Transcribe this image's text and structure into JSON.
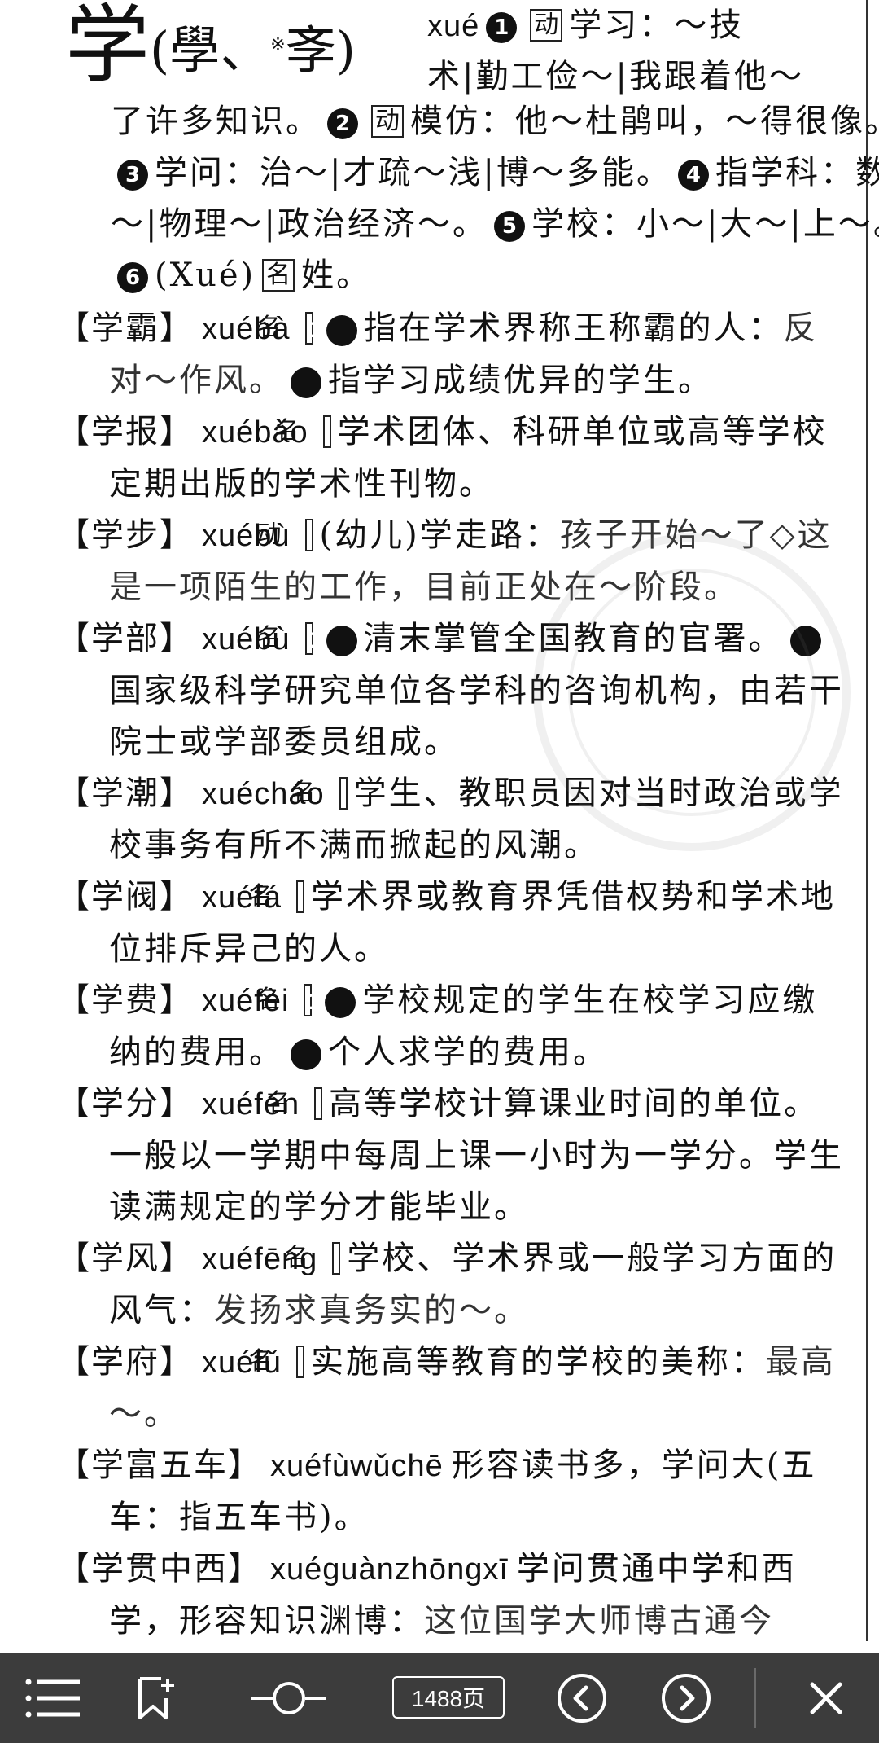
{
  "head_entry": {
    "char": "学",
    "variants_open": "(",
    "variant_1": "學",
    "variant_sep": "、",
    "variant_star": "※",
    "variant_2": "斈",
    "variants_close": ")",
    "pinyin": "xué",
    "num1": "1",
    "pos1": "动",
    "def1": "学习：～技",
    "line2": "术|勤工俭～|我跟着他～",
    "rest_1": "了许多知识。",
    "num2": "2",
    "pos2": "动",
    "def2": "模仿：他～杜鹃叫，～得很像。",
    "num3": "3",
    "def3": "学问：治～|才疏～浅|博～多能。",
    "num4": "4",
    "def4": "指学科：数～|物理～|政治经济～。",
    "num5": "5",
    "def5": "学校：小～|大～|上～。",
    "num6": "6",
    "def6_surname_pinyin": "(Xué)",
    "pos6": "名",
    "def6": "姓。"
  },
  "entries": [
    {
      "headword": "【学霸】",
      "pinyin": "xuébà",
      "pos": "名",
      "segments": [
        {
          "num": "1",
          "text": "指在学术界称王称霸的人："
        },
        {
          "example": "反对～作风。"
        },
        {
          "num": "2",
          "text": "指学习成绩优异的学生。"
        }
      ]
    },
    {
      "headword": "【学报】",
      "pinyin": "xuébào",
      "pos": "名",
      "segments": [
        {
          "text": "学术团体、科研单位或高等学校定期出版的学术性刊物。"
        }
      ]
    },
    {
      "headword": "【学步】",
      "pinyin": "xuébù",
      "pos": "动",
      "segments": [
        {
          "text": "(幼儿)学走路："
        },
        {
          "example": "孩子开始～了◇这是一项陌生的工作，目前正处在～阶段。"
        }
      ]
    },
    {
      "headword": "【学部】",
      "pinyin": "xuébù",
      "pos": "名",
      "segments": [
        {
          "num": "1",
          "text": "清末掌管全国教育的官署。"
        },
        {
          "num": "2",
          "text": "国家级科学研究单位各学科的咨询机构，由若干院士或学部委员组成。"
        }
      ]
    },
    {
      "headword": "【学潮】",
      "pinyin": "xuécháo",
      "pos": "名",
      "segments": [
        {
          "text": "学生、教职员因对当时政治或学校事务有所不满而掀起的风潮。"
        }
      ]
    },
    {
      "headword": "【学阀】",
      "pinyin": "xuéfá",
      "pos": "名",
      "segments": [
        {
          "text": "学术界或教育界凭借权势和学术地位排斥异己的人。"
        }
      ]
    },
    {
      "headword": "【学费】",
      "pinyin": "xuéfèi",
      "pos": "名",
      "segments": [
        {
          "num": "1",
          "text": "学校规定的学生在校学习应缴纳的费用。"
        },
        {
          "num": "2",
          "text": "个人求学的费用。"
        }
      ]
    },
    {
      "headword": "【学分】",
      "pinyin": "xuéfēn",
      "pos": "名",
      "segments": [
        {
          "text": "高等学校计算课业时间的单位。一般以一学期中每周上课一小时为一学分。学生读满规定的学分才能毕业。"
        }
      ]
    },
    {
      "headword": "【学风】",
      "pinyin": "xuéfēng",
      "pos": "名",
      "segments": [
        {
          "text": "学校、学术界或一般学习方面的风气："
        },
        {
          "example": "发扬求真务实的～。"
        }
      ]
    },
    {
      "headword": "【学府】",
      "pinyin": "xuéfǔ",
      "pos": "名",
      "segments": [
        {
          "text": "实施高等教育的学校的美称："
        },
        {
          "example": "最高～。"
        }
      ]
    },
    {
      "headword": "【学富五车】",
      "pinyin": "xuéfùwǔchē",
      "pos": "",
      "segments": [
        {
          "text": "形容读书多，学问大(五车：指五车书)。"
        }
      ]
    },
    {
      "headword": "【学贯中西】",
      "pinyin": "xuéguànzhōngxī",
      "pos": "",
      "segments": [
        {
          "text": "学问贯通中学和西学，形容知识渊博："
        },
        {
          "example": "这位国学大师博古通今"
        }
      ]
    }
  ],
  "toolbar": {
    "page_label": "1488页",
    "icons": [
      "menu-icon",
      "bookmark-add-icon",
      "zoom-slider-icon",
      "prev-page-icon",
      "next-page-icon",
      "close-icon"
    ],
    "background": "#3c3c3c",
    "icon_color": "#ffffff"
  }
}
